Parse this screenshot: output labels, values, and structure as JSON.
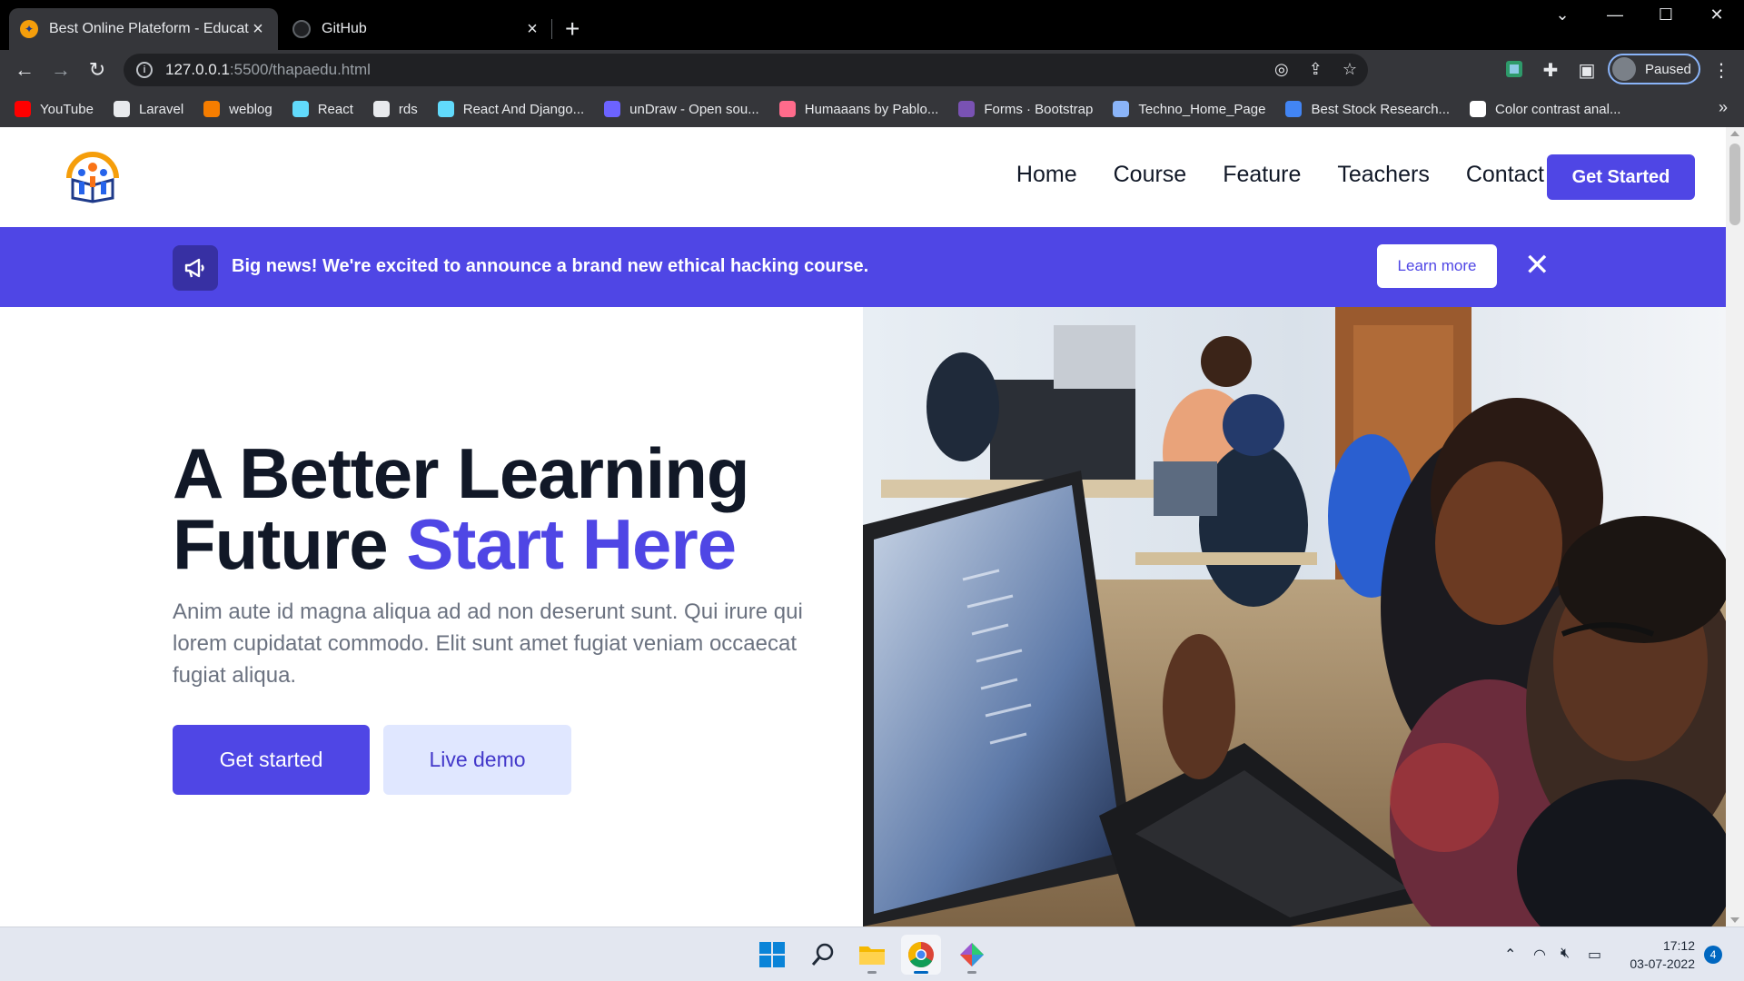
{
  "browser": {
    "tabs": [
      {
        "title": "Best Online Plateform - Education",
        "active": true
      },
      {
        "title": "GitHub",
        "active": false
      }
    ],
    "url_host": "127.0.0.1",
    "url_path": ":5500/thapaedu.html",
    "profile_status": "Paused",
    "bookmarks": [
      {
        "label": "YouTube",
        "icon": "youtube-icon",
        "color": "#ff0000"
      },
      {
        "label": "Laravel",
        "icon": "globe-icon",
        "color": "#e8eaed"
      },
      {
        "label": "weblog",
        "icon": "blogger-icon",
        "color": "#f57d00"
      },
      {
        "label": "React",
        "icon": "react-icon",
        "color": "#61dafb"
      },
      {
        "label": "rds",
        "icon": "globe-icon",
        "color": "#e8eaed"
      },
      {
        "label": "React And Django...",
        "icon": "react-icon",
        "color": "#61dafb"
      },
      {
        "label": "unDraw - Open sou...",
        "icon": "undraw-icon",
        "color": "#6c63ff"
      },
      {
        "label": "Humaaans by Pablo...",
        "icon": "humaaans-icon",
        "color": "#ff6b8b"
      },
      {
        "label": "Forms · Bootstrap",
        "icon": "bootstrap-icon",
        "color": "#7952b3"
      },
      {
        "label": "Techno_Home_Page",
        "icon": "page-icon",
        "color": "#8ab4f8"
      },
      {
        "label": "Best Stock Research...",
        "icon": "circle-icon",
        "color": "#4285f4"
      },
      {
        "label": "Color contrast anal...",
        "icon": "contrast-icon",
        "color": "#ffffff"
      }
    ]
  },
  "site": {
    "nav": [
      "Home",
      "Course",
      "Feature",
      "Teachers",
      "Contact"
    ],
    "cta": "Get Started",
    "banner": {
      "message": "Big news! We're excited to announce a brand new ethical hacking course.",
      "button": "Learn more"
    },
    "hero": {
      "title_line1": "A Better Learning",
      "title_line2_plain": "Future ",
      "title_line2_accent": "Start Here",
      "description": "Anim aute id magna aliqua ad ad non deserunt sunt. Qui irure qui lorem cupidatat commodo. Elit sunt amet fugiat veniam occaecat fugiat aliqua.",
      "primary_button": "Get started",
      "secondary_button": "Live demo"
    },
    "colors": {
      "accent": "#4f46e5",
      "accent_light": "#e0e7ff",
      "heading": "#111827",
      "body_text": "#6b7280"
    }
  },
  "taskbar": {
    "time": "17:12",
    "date": "03-07-2022",
    "notifications": "4"
  }
}
